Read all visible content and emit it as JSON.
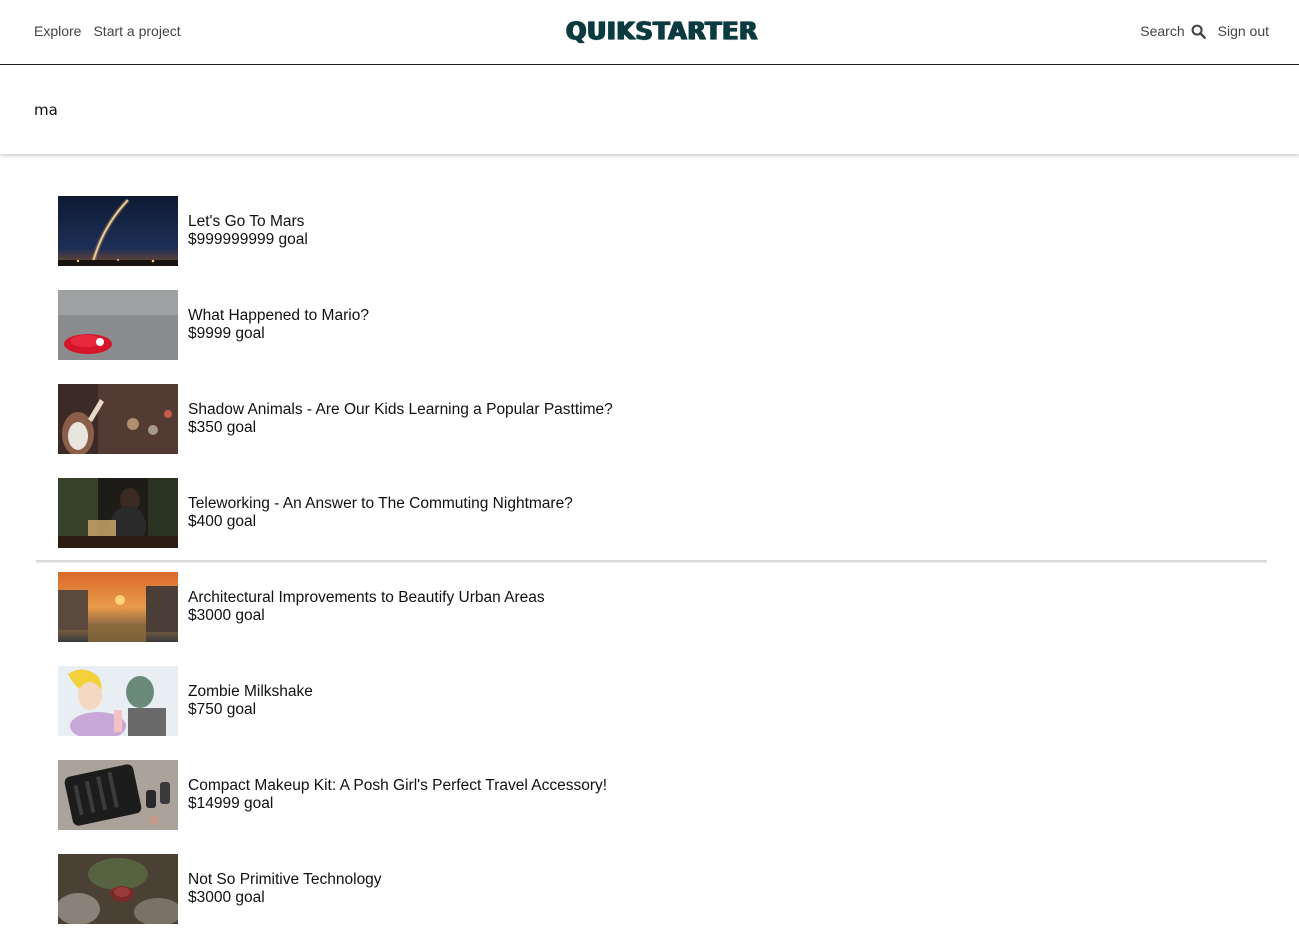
{
  "header": {
    "nav_left": [
      "Explore",
      "Start a project"
    ],
    "logo": "QUIKSTARTER",
    "search_label": "Search",
    "signout_label": "Sign out"
  },
  "search": {
    "value": "ma"
  },
  "results": [
    {
      "title": "Let's Go To Mars",
      "goal": "$999999999 goal",
      "thumb": "rocket-launch-night-sky"
    },
    {
      "title": "What Happened to Mario?",
      "goal": "$9999 goal",
      "thumb": "red-cap-on-asphalt"
    },
    {
      "title": "Shadow Animals - Are Our Kids Learning a Popular Pasttime?",
      "goal": "$350 goal",
      "thumb": "hand-shadow-city-lights"
    },
    {
      "title": "Teleworking - An Answer to The Commuting Nightmare?",
      "goal": "$400 goal",
      "thumb": "person-laptop-cafe"
    },
    {
      "title": "Architectural Improvements to Beautify Urban Areas",
      "goal": "$3000 goal",
      "thumb": "canal-city-sunset"
    },
    {
      "title": "Zombie Milkshake",
      "goal": "$750 goal",
      "thumb": "pop-art-zombie-couple"
    },
    {
      "title": "Compact Makeup Kit: A Posh Girl's Perfect Travel Accessory!",
      "goal": "$14999 goal",
      "thumb": "makeup-brush-case"
    },
    {
      "title": "Not So Primitive Technology",
      "goal": "$3000 goal",
      "thumb": "cap-on-rocks"
    }
  ],
  "colors": {
    "logo": "#0b3a3f",
    "header_border": "#1f1f1f",
    "divider": "#d8d8d8"
  }
}
